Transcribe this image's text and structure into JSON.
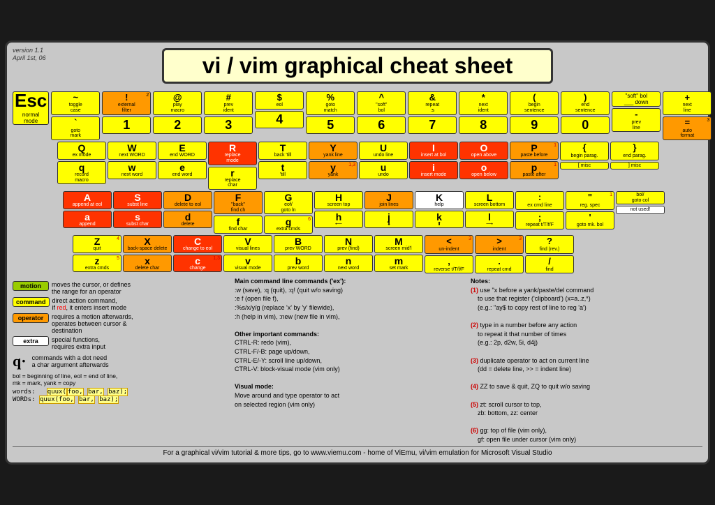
{
  "meta": {
    "version": "version 1.1",
    "date": "April 1st, 06"
  },
  "title": "vi / vim graphical cheat sheet",
  "esc": {
    "label": "Esc",
    "sub1": "normal",
    "sub2": "mode"
  },
  "footer": "For a graphical vi/vim tutorial & more tips, go to   www.viemu.com  - home of ViEmu, vi/vim emulation for Microsoft Visual Studio",
  "legend": {
    "motion": {
      "label": "motion",
      "desc": "moves the cursor, or defines\nthe range for an operator"
    },
    "command": {
      "label": "command",
      "desc": "direct action command,\nif red, it enters insert mode"
    },
    "operator": {
      "label": "operator",
      "desc": "requires a motion afterwards,\noperates between cursor &\ndestination"
    },
    "extra": {
      "label": "extra",
      "desc": "special functions,\nrequires extra input"
    },
    "dot": {
      "desc": "commands with a dot need\na char argument afterwards"
    }
  },
  "bol_note": "bol = beginning of line, eol = end of line,\nmk = mark, yank = copy",
  "words_line": "words:   quux(foo, bar, baz);",
  "words_caps": "WORDs:  quux(foo, bar, baz);",
  "main_commands": {
    "title": "Main command line commands ('ex'):",
    "items": [
      ":w (save), :q (quit), :q! (quit w/o saving)",
      ":e f (open file f),",
      ":%s/x/y/g (replace 'x' by 'y' filewide),",
      ":h (help in vim), :new (new file in vim),"
    ]
  },
  "other_commands": {
    "title": "Other important commands:",
    "items": [
      "CTRL-R: redo (vim),",
      "CTRL-F/-B: page up/down,",
      "CTRL-E/-Y: scroll line up/down,",
      "CTRL-V: block-visual mode (vim only)"
    ]
  },
  "visual_mode": {
    "title": "Visual mode:",
    "desc": "Move around and type operator to act\non selected region (vim only)"
  },
  "notes": {
    "title": "Notes:",
    "items": [
      "use \"x before a yank/paste/del command\nto use that register ('clipboard') (x=a..z,*)\n(e.g.: \"ay$ to copy rest of line to reg 'a')",
      "type in a number before any action\nto repeat it that number of times\n(e.g.: 2p, d2w, 5i, d4j)",
      "duplicate operator to act on current line\n(dd = delete line, >> = indent line)",
      "ZZ to save & quit, ZQ to quit w/o saving",
      "zt: scroll cursor to top,\nzb: bottom, zz: center",
      "gg: top of file (vim only),\ngf: open file under cursor (vim only)"
    ]
  }
}
